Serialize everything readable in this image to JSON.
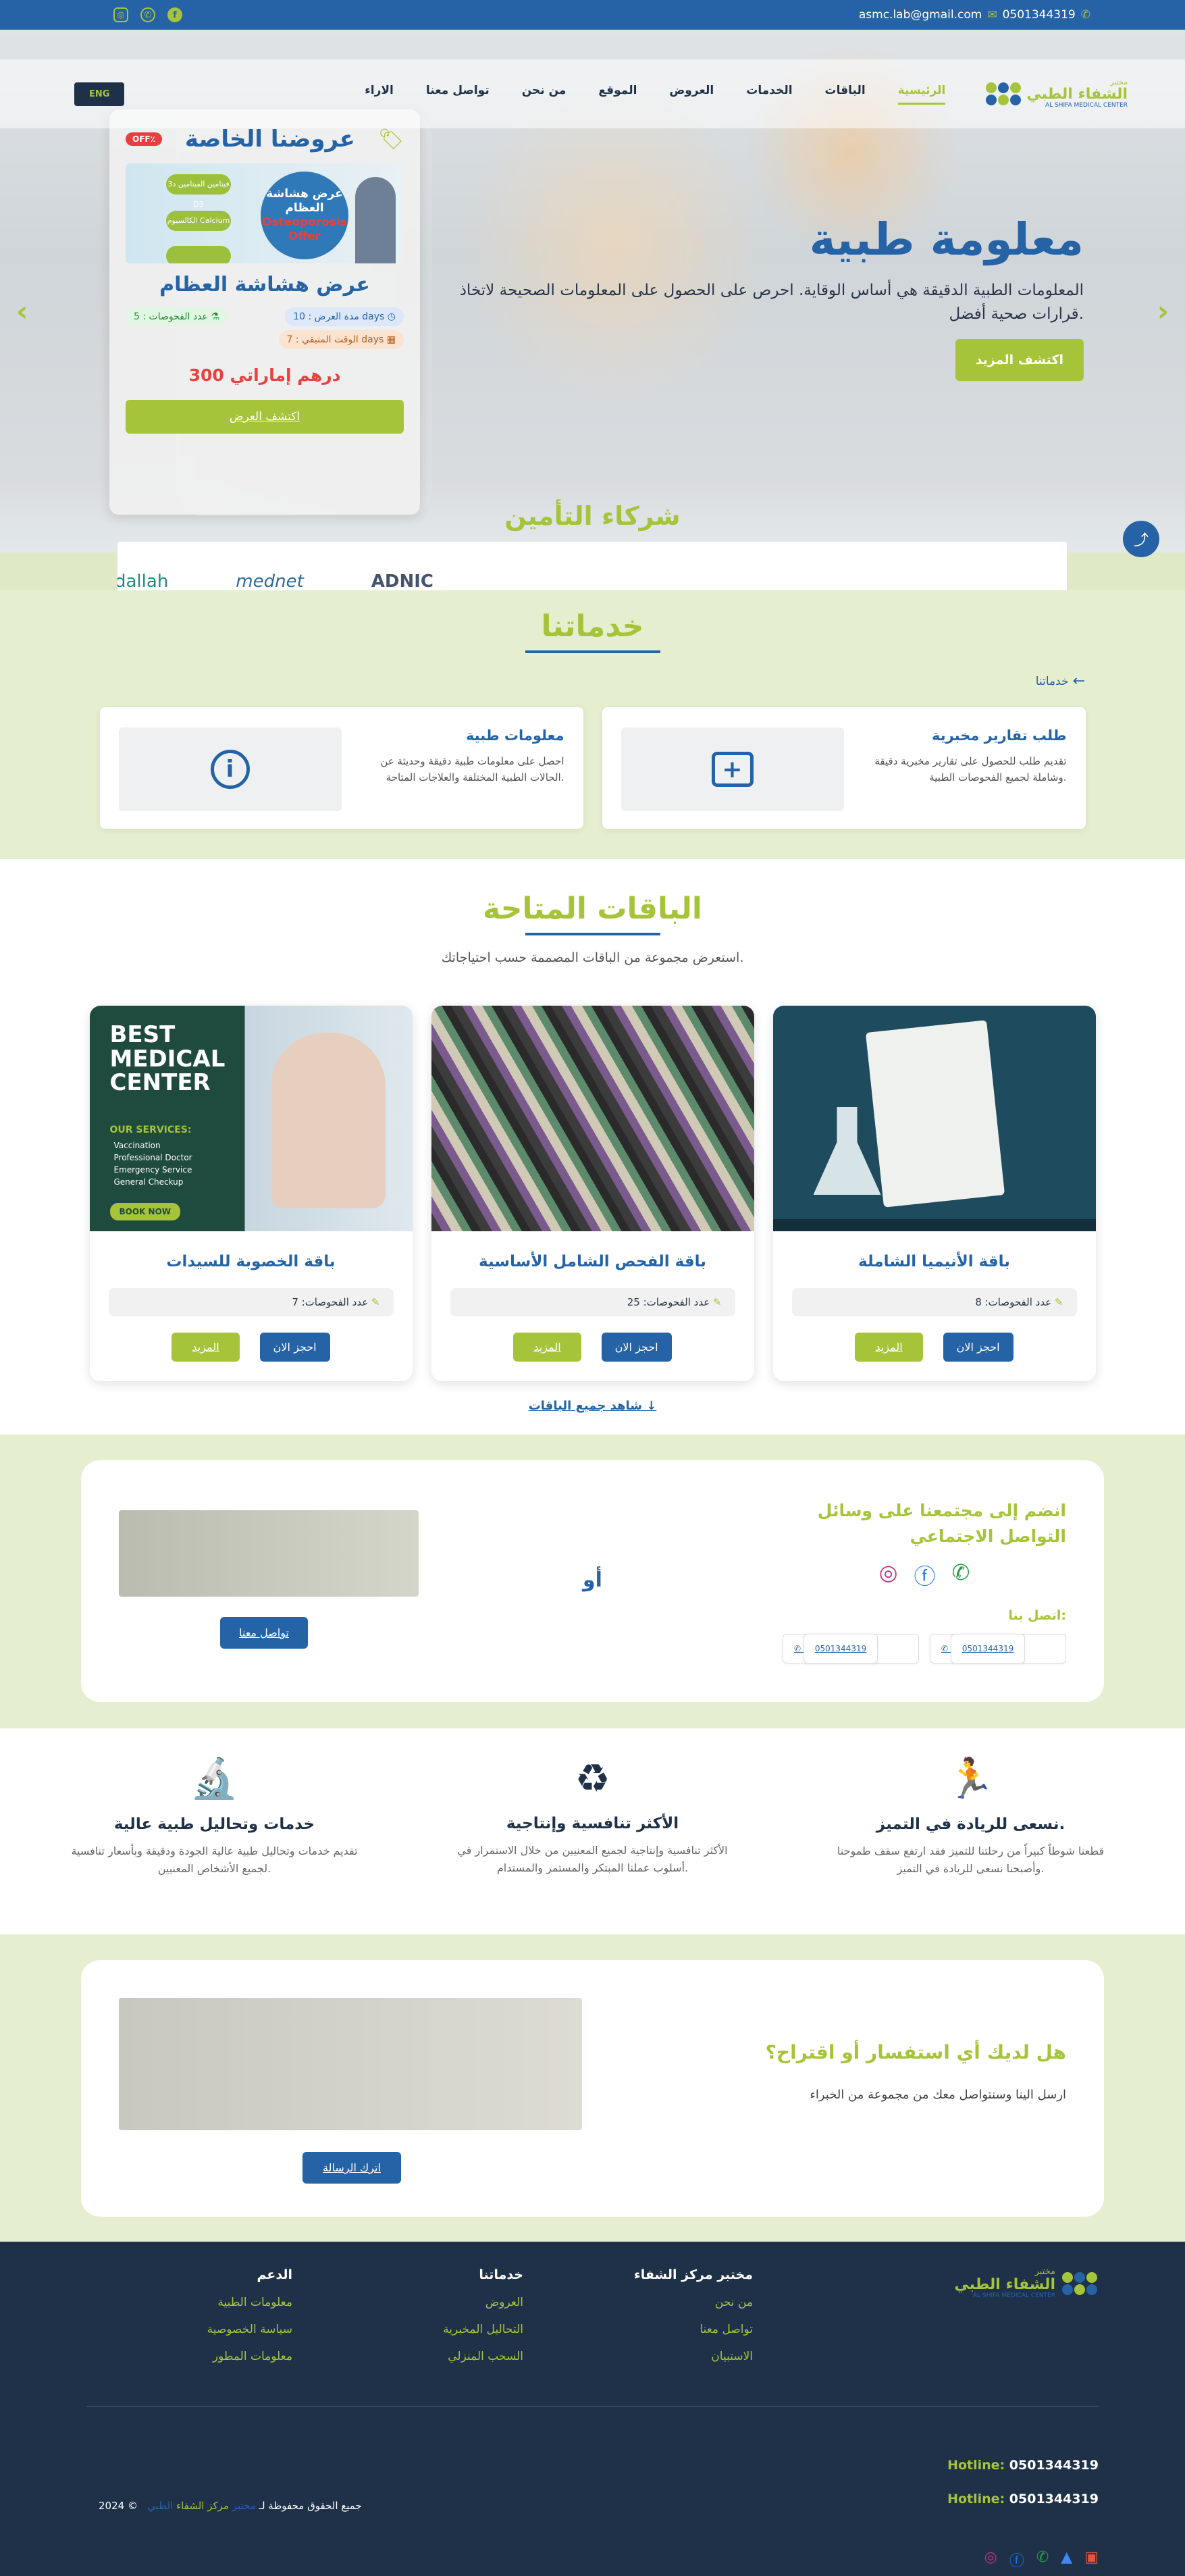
{
  "topbar": {
    "phone": "0501344319",
    "email": "asmc.lab@gmail.com"
  },
  "nav": {
    "lang": "ENG",
    "items": [
      "الرئيسية",
      "الباقات",
      "الخدمات",
      "العروض",
      "الموقع",
      "من نحن",
      "تواصل معنا",
      "الاراء"
    ],
    "logo_ar_top": "مختبر",
    "logo_ar": "الشفاء الطبي",
    "logo_en": "AL SHIFA MEDICAL CENTER"
  },
  "hero": {
    "title": "معلومة طبية",
    "text": "المعلومات الطبية الدقيقة هي أساس الوقاية. احرص على الحصول على المعلومات الصحيحة لاتخاذ قرارات صحية أفضل.",
    "button": "اكتشف المزيد"
  },
  "offer": {
    "badge": "OFF٪",
    "heading": "عروضنا الخاصة",
    "img_title_ar": "عرض هشاشة العظام",
    "img_title_en": "Osteoporosis Offer",
    "img_items": [
      "فيتامين الفيتامين د3 D3",
      "الكالسيوم Calcium"
    ],
    "name": "عرض هشاشة العظام",
    "duration": "مدة العرض : 10 days",
    "tests": "عدد الفحوصات : 5",
    "remaining": "الوقت المتبقي : 7 days",
    "price": "300 درهم إماراتي",
    "button": "اكتشف العرض"
  },
  "insurance": {
    "title": "شركاء التأمين",
    "partners": [
      "dallah",
      "mednet",
      "ADNIC"
    ]
  },
  "services": {
    "title": "خدماتنا",
    "back": "خدماتنا",
    "cards": [
      {
        "title": "معلومات طبية",
        "text": "احصل على معلومات طبية دقيقة وحديثة عن الحالات الطبية المختلفة والعلاجات المتاحة."
      },
      {
        "title": "طلب تقارير مخبرية",
        "text": "تقديم طلب للحصول على تقارير مخبرية دقيقة وشاملة لجميع الفحوصات الطبية."
      }
    ]
  },
  "packages": {
    "title": "الباقات المتاحة",
    "subtitle": "استعرض مجموعة من الباقات المصممة حسب احتياجاتك.",
    "items": [
      {
        "name": "باقة الأنيميا الشاملة",
        "count": "عدد الفحوصات: 8"
      },
      {
        "name": "باقة الفحص الشامل الأساسية",
        "count": "عدد الفحوصات: 25"
      },
      {
        "name": "باقة الخصوبة للسيدات",
        "count": "عدد الفحوصات: 7"
      }
    ],
    "book": "احجز الان",
    "more": "المزيد",
    "poster_title": "BEST MEDICAL CENTER",
    "poster_services_title": "OUR SERVICES:",
    "poster_services": [
      "Vaccination",
      "Professional Doctor",
      "Emergency Service",
      "General Checkup"
    ],
    "poster_button": "BOOK NOW",
    "see_all": "شاهد جميع الباقات"
  },
  "join": {
    "title": "انضم إلى مجتمعنا على وسائل التواصل الاجتماعي",
    "call": "اتصل بنا:",
    "phones": [
      "0501344319",
      "0501344319"
    ],
    "or": "أو",
    "button": "تواصل معنا"
  },
  "features": [
    {
      "title": "نسعى للريادة في التميز.",
      "text": "قطعنا شوطاً كبيراً من رحلتنا للتميز فقد ارتفع سقف طموحنا وأصبحنا نسعى للريادة في التميز."
    },
    {
      "title": "الأكثر تنافسية وإنتاجية",
      "text": "الأكثر تنافسية وإنتاجية لجميع المعنيين من خلال الاستمرار في أسلوب عملنا المبتكر والمستمر والمستدام."
    },
    {
      "title": "خدمات وتحاليل طبية عالية",
      "text": "تقديم خدمات وتحاليل طبية عالية الجودة ودقيقة وبأسعار تنافسية لجميع الأشخاص المعنيين."
    }
  ],
  "inquiry": {
    "title": "هل لديك أي استفسار أو اقتراح؟",
    "text": "ارسل الينا وسنتواصل معك من مجموعة من الخبراء",
    "button": "اترك الرسالة"
  },
  "footer": {
    "col1": {
      "title": "مختبر مركز الشفاء",
      "links": [
        "من نحن",
        "تواصل معنا",
        "الاستبيان"
      ]
    },
    "col2": {
      "title": "خدماتنا",
      "links": [
        "العروض",
        "التحاليل المخبرية",
        "السحب المنزلي"
      ]
    },
    "col3": {
      "title": "الدعم",
      "links": [
        "معلومات الطبية",
        "سياسة الخصوصية",
        "معلومات المطور"
      ]
    },
    "hotline_label": "Hotline:",
    "hotline": "0501344319",
    "copy_prefix": "جميع الحقوق محفوظة لـ",
    "copy_brand1": "مختبر",
    "copy_brand2": "مركز الشفاء",
    "copy_brand3": "الطبي",
    "year": "2024 ©"
  }
}
